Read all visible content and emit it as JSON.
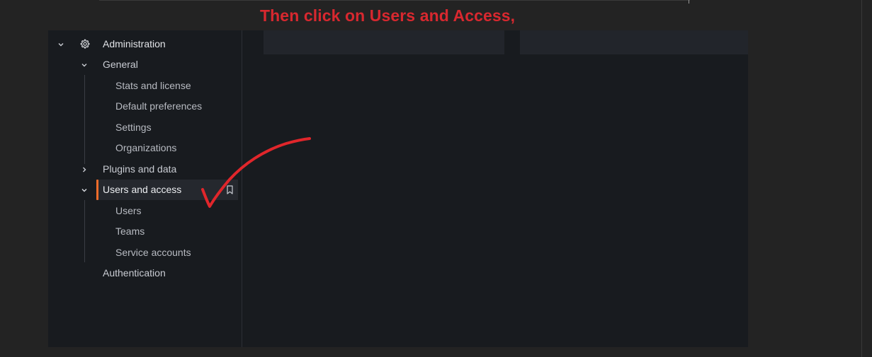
{
  "caption": "Then click on Users and Access,",
  "sidebar": {
    "root": {
      "label": "Administration",
      "icon": "gear-icon",
      "expanded": true
    },
    "general": {
      "label": "General",
      "expanded": true,
      "items": [
        {
          "label": "Stats and license"
        },
        {
          "label": "Default preferences"
        },
        {
          "label": "Settings"
        },
        {
          "label": "Organizations"
        }
      ]
    },
    "plugins": {
      "label": "Plugins and data",
      "expanded": false
    },
    "users_access": {
      "label": "Users and access",
      "expanded": true,
      "active": true,
      "items": [
        {
          "label": "Users"
        },
        {
          "label": "Teams"
        },
        {
          "label": "Service accounts"
        }
      ]
    },
    "authentication": {
      "label": "Authentication"
    }
  },
  "colors": {
    "background": "#232323",
    "panel": "#181b1f",
    "caption": "#d8282f",
    "active_bar": "#f06c2a",
    "annotation": "#e0262b"
  }
}
